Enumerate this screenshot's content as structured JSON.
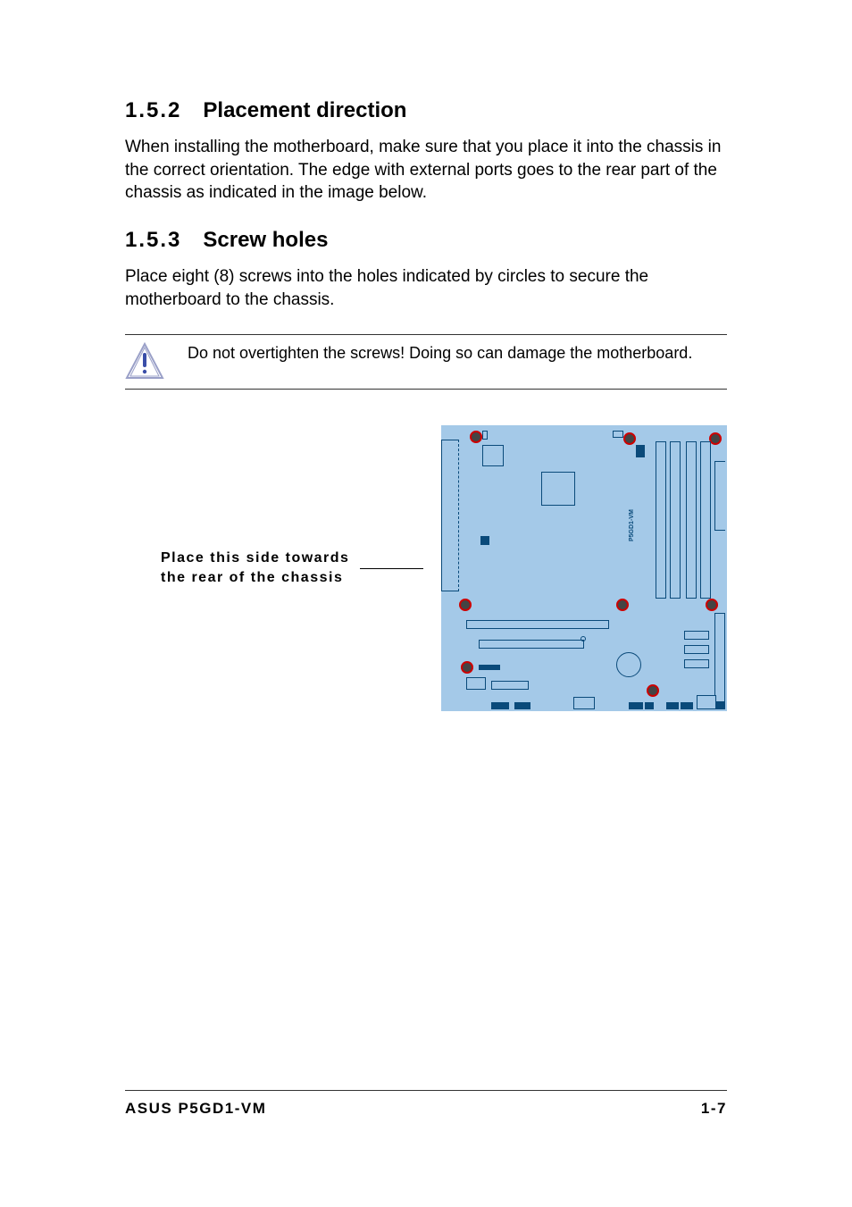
{
  "sections": {
    "placement": {
      "number": "1.5.2",
      "title": "Placement direction",
      "text": "When installing the motherboard, make sure that you place it into the chassis in the correct orientation. The edge with external ports goes to the rear part of the chassis as indicated in the image below."
    },
    "screw": {
      "number": "1.5.3",
      "title": "Screw holes",
      "text": "Place eight (8) screws into the holes indicated by circles to secure the motherboard to the chassis."
    }
  },
  "callout": {
    "text": "Do not overtighten the screws! Doing so can damage the motherboard."
  },
  "diagram": {
    "label_line1": "Place this side towards",
    "label_line2": "the rear of the chassis",
    "board_label": "P5GD1-VM"
  },
  "footer": {
    "left": "ASUS P5GD1-VM",
    "right": "1-7"
  }
}
